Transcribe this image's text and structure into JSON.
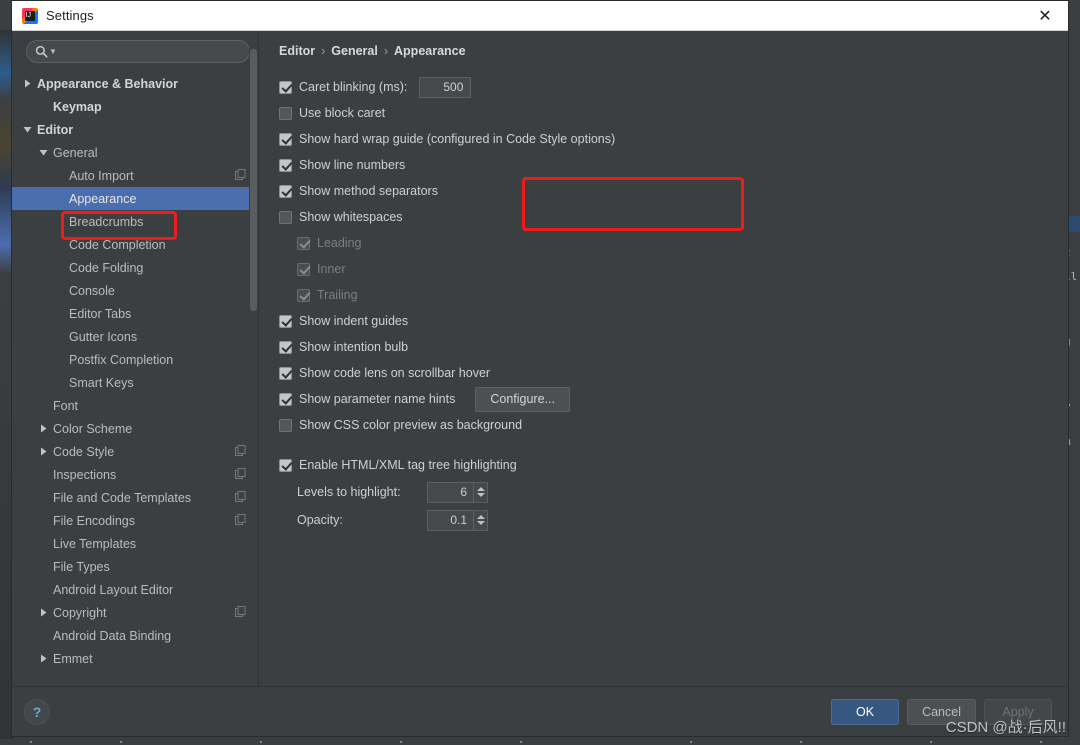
{
  "window": {
    "title": "Settings",
    "app_icon": "intellij-idea-icon",
    "close_label": "✕"
  },
  "search": {
    "value": "",
    "placeholder": "",
    "icon": "search-icon"
  },
  "sidebar": {
    "items": [
      {
        "label": "Appearance & Behavior",
        "indent": 0,
        "arrow": "collapsed",
        "bold": true,
        "selected": false,
        "copy_icon": false
      },
      {
        "label": "Keymap",
        "indent": 1,
        "arrow": "none",
        "bold": true,
        "selected": false,
        "copy_icon": false
      },
      {
        "label": "Editor",
        "indent": 0,
        "arrow": "expanded",
        "bold": true,
        "selected": false,
        "copy_icon": false
      },
      {
        "label": "General",
        "indent": 1,
        "arrow": "expanded",
        "bold": false,
        "selected": false,
        "copy_icon": false
      },
      {
        "label": "Auto Import",
        "indent": 2,
        "arrow": "none",
        "bold": false,
        "selected": false,
        "copy_icon": true
      },
      {
        "label": "Appearance",
        "indent": 2,
        "arrow": "none",
        "bold": false,
        "selected": true,
        "copy_icon": false
      },
      {
        "label": "Breadcrumbs",
        "indent": 2,
        "arrow": "none",
        "bold": false,
        "selected": false,
        "copy_icon": false
      },
      {
        "label": "Code Completion",
        "indent": 2,
        "arrow": "none",
        "bold": false,
        "selected": false,
        "copy_icon": false
      },
      {
        "label": "Code Folding",
        "indent": 2,
        "arrow": "none",
        "bold": false,
        "selected": false,
        "copy_icon": false
      },
      {
        "label": "Console",
        "indent": 2,
        "arrow": "none",
        "bold": false,
        "selected": false,
        "copy_icon": false
      },
      {
        "label": "Editor Tabs",
        "indent": 2,
        "arrow": "none",
        "bold": false,
        "selected": false,
        "copy_icon": false
      },
      {
        "label": "Gutter Icons",
        "indent": 2,
        "arrow": "none",
        "bold": false,
        "selected": false,
        "copy_icon": false
      },
      {
        "label": "Postfix Completion",
        "indent": 2,
        "arrow": "none",
        "bold": false,
        "selected": false,
        "copy_icon": false
      },
      {
        "label": "Smart Keys",
        "indent": 2,
        "arrow": "none",
        "bold": false,
        "selected": false,
        "copy_icon": false
      },
      {
        "label": "Font",
        "indent": 1,
        "arrow": "none",
        "bold": false,
        "selected": false,
        "copy_icon": false
      },
      {
        "label": "Color Scheme",
        "indent": 1,
        "arrow": "collapsed",
        "bold": false,
        "selected": false,
        "copy_icon": false
      },
      {
        "label": "Code Style",
        "indent": 1,
        "arrow": "collapsed",
        "bold": false,
        "selected": false,
        "copy_icon": true
      },
      {
        "label": "Inspections",
        "indent": 1,
        "arrow": "none",
        "bold": false,
        "selected": false,
        "copy_icon": true
      },
      {
        "label": "File and Code Templates",
        "indent": 1,
        "arrow": "none",
        "bold": false,
        "selected": false,
        "copy_icon": true
      },
      {
        "label": "File Encodings",
        "indent": 1,
        "arrow": "none",
        "bold": false,
        "selected": false,
        "copy_icon": true
      },
      {
        "label": "Live Templates",
        "indent": 1,
        "arrow": "none",
        "bold": false,
        "selected": false,
        "copy_icon": false
      },
      {
        "label": "File Types",
        "indent": 1,
        "arrow": "none",
        "bold": false,
        "selected": false,
        "copy_icon": false
      },
      {
        "label": "Android Layout Editor",
        "indent": 1,
        "arrow": "none",
        "bold": false,
        "selected": false,
        "copy_icon": false
      },
      {
        "label": "Copyright",
        "indent": 1,
        "arrow": "collapsed",
        "bold": false,
        "selected": false,
        "copy_icon": true
      },
      {
        "label": "Android Data Binding",
        "indent": 1,
        "arrow": "none",
        "bold": false,
        "selected": false,
        "copy_icon": false
      },
      {
        "label": "Emmet",
        "indent": 1,
        "arrow": "collapsed",
        "bold": false,
        "selected": false,
        "copy_icon": false
      }
    ]
  },
  "main": {
    "breadcrumb": [
      "Editor",
      "General",
      "Appearance"
    ],
    "breadcrumb_separator": "›",
    "options": [
      {
        "kind": "check-field",
        "label": "Caret blinking (ms):",
        "checked": true,
        "disabled": false,
        "indent": 0,
        "field_value": "500"
      },
      {
        "kind": "check",
        "label": "Use block caret",
        "checked": false,
        "disabled": false,
        "indent": 0
      },
      {
        "kind": "check",
        "label": "Show hard wrap guide (configured in Code Style options)",
        "checked": true,
        "disabled": false,
        "indent": 0
      },
      {
        "kind": "check",
        "label": "Show line numbers",
        "checked": true,
        "disabled": false,
        "indent": 0
      },
      {
        "kind": "check",
        "label": "Show method separators",
        "checked": true,
        "disabled": false,
        "indent": 0
      },
      {
        "kind": "check",
        "label": "Show whitespaces",
        "checked": false,
        "disabled": false,
        "indent": 0
      },
      {
        "kind": "check",
        "label": "Leading",
        "checked": true,
        "disabled": true,
        "indent": 1
      },
      {
        "kind": "check",
        "label": "Inner",
        "checked": true,
        "disabled": true,
        "indent": 1
      },
      {
        "kind": "check",
        "label": "Trailing",
        "checked": true,
        "disabled": true,
        "indent": 1
      },
      {
        "kind": "check",
        "label": "Show indent guides",
        "checked": true,
        "disabled": false,
        "indent": 0
      },
      {
        "kind": "check",
        "label": "Show intention bulb",
        "checked": true,
        "disabled": false,
        "indent": 0
      },
      {
        "kind": "check",
        "label": "Show code lens on scrollbar hover",
        "checked": true,
        "disabled": false,
        "indent": 0
      },
      {
        "kind": "check-button",
        "label": "Show parameter name hints",
        "checked": true,
        "disabled": false,
        "indent": 0,
        "button_label": "Configure..."
      },
      {
        "kind": "check",
        "label": "Show CSS color preview as background",
        "checked": false,
        "disabled": false,
        "indent": 0
      },
      {
        "kind": "gap"
      },
      {
        "kind": "check",
        "label": "Enable HTML/XML tag tree highlighting",
        "checked": true,
        "disabled": false,
        "indent": 0
      },
      {
        "kind": "spinner",
        "label": "Levels to highlight:",
        "value": "6",
        "indent": 1
      },
      {
        "kind": "spinner",
        "label": "Opacity:",
        "value": "0.1",
        "indent": 1
      }
    ]
  },
  "footer": {
    "help_label": "?",
    "ok_label": "OK",
    "cancel_label": "Cancel",
    "apply_label": "Apply"
  },
  "annotations": {
    "sidebar_highlight": "Appearance",
    "options_highlight": "Show line numbers / Show method separators",
    "color": "#f01c1c"
  },
  "watermark": {
    "text": "CSDN @战·后风!!"
  },
  "background_editor": {
    "right_fragments": [
      "t",
      "il",
      "g",
      "y",
      "m",
      "l"
    ]
  },
  "colors": {
    "dialog_bg": "#3c3f41",
    "selection_blue": "#4b6eaf",
    "primary_button": "#365880",
    "accent_red": "#f01c1c",
    "text": "#bbbbbb"
  }
}
